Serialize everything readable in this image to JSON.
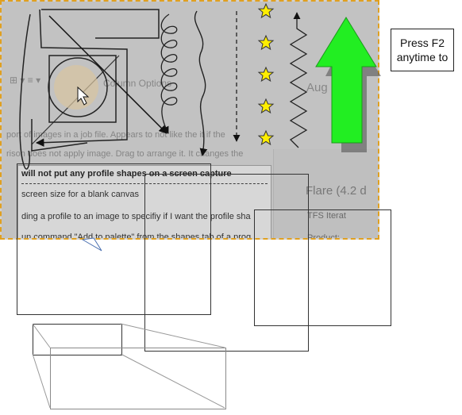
{
  "capture": {
    "background_texts": [
      "port of images in a job file. Appears to not like the it if the",
      "rison does not apply image. Drag to arrange it. It changes the",
      "Column Options",
      "Aug 24"
    ],
    "list_items": [
      "will not put any profile shapes on a screen capture",
      "screen size for a blank canvas",
      "ding a profile to an image to specifiy if I want the profile sha",
      "un command \"Add to palette\" from the shapes tab of a prog"
    ],
    "right_panel": {
      "flare_label": "Flare (4.2 d",
      "tfs_label": "TFS Iterat",
      "product_label": "Product:"
    }
  },
  "note": {
    "line1": "Press F2",
    "line2": "anytime to"
  },
  "colors": {
    "capture_border": "#e0a020",
    "arrow_green": "#22ee22",
    "star_yellow": "#ffee00"
  },
  "icons": [
    "cursor-arrow-icon",
    "star-icon",
    "green-up-arrow-icon"
  ]
}
